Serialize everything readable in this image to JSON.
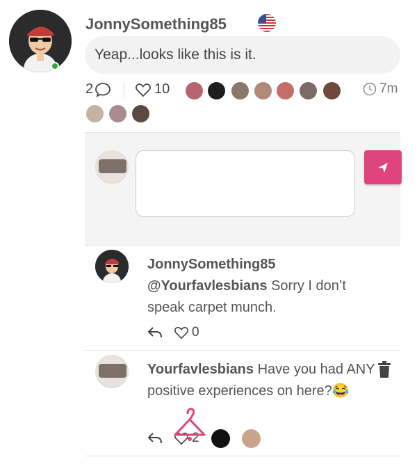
{
  "post": {
    "username": "JonnySomething85",
    "message": "Yeap...looks like this is it.",
    "comment_count": "2",
    "like_count": "10",
    "time": "7m"
  },
  "comments": [
    {
      "username": "JonnySomething85",
      "mention": "@Yourfavlesbians",
      "text": " Sorry I don’t speak carpet munch.",
      "like_count": "0"
    },
    {
      "username": "Yourfavlesbians",
      "text": " Have you had ANY positive experiences on here?😂",
      "like_count": "2"
    }
  ],
  "colors": {
    "accent": "#e0447c",
    "online": "#3aa53a"
  }
}
